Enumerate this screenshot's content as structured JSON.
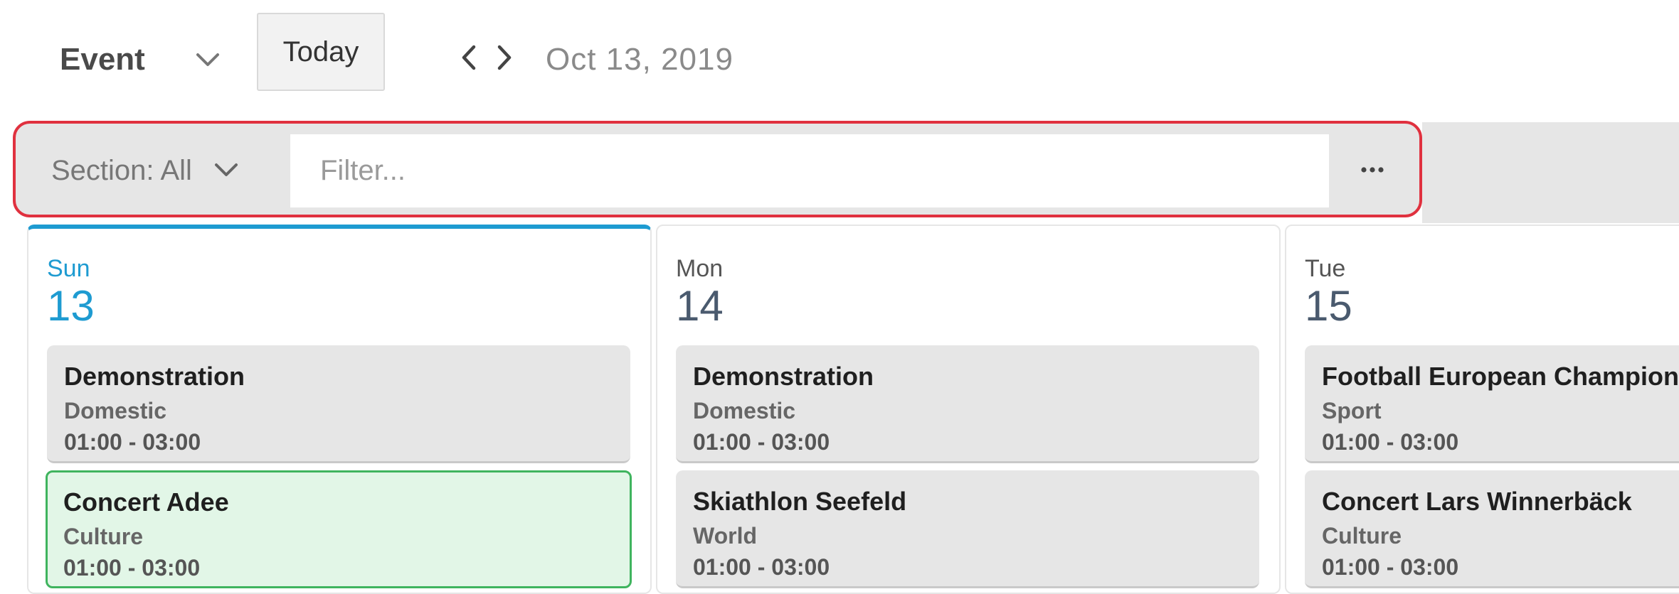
{
  "header": {
    "view_label": "Event",
    "today_label": "Today",
    "date": "Oct 13, 2019"
  },
  "filter": {
    "section_label": "Section: All",
    "placeholder": "Filter...",
    "more_icon": "ellipsis-icon"
  },
  "colors": {
    "accent": "#1e9bd1",
    "highlight_border": "#3fb45e",
    "highlight_bg": "#e2f6e7",
    "filter_outline": "#e0313f"
  },
  "days": [
    {
      "name": "Sun",
      "number": "13",
      "active": true,
      "events": [
        {
          "title": "Demonstration",
          "section": "Domestic",
          "time": "01:00 - 03:00"
        },
        {
          "title": "Concert Adee",
          "section": "Culture",
          "time": "01:00 - 03:00",
          "highlight": true
        }
      ]
    },
    {
      "name": "Mon",
      "number": "14",
      "active": false,
      "events": [
        {
          "title": "Demonstration",
          "section": "Domestic",
          "time": "01:00 - 03:00"
        },
        {
          "title": "Skiathlon Seefeld",
          "section": "World",
          "time": "01:00 - 03:00"
        }
      ]
    },
    {
      "name": "Tue",
      "number": "15",
      "active": false,
      "events": [
        {
          "title": "Football European Championship",
          "section": "Sport",
          "time": "01:00 - 03:00"
        },
        {
          "title": "Concert Lars Winnerbäck",
          "section": "Culture",
          "time": "01:00 - 03:00"
        }
      ]
    }
  ]
}
